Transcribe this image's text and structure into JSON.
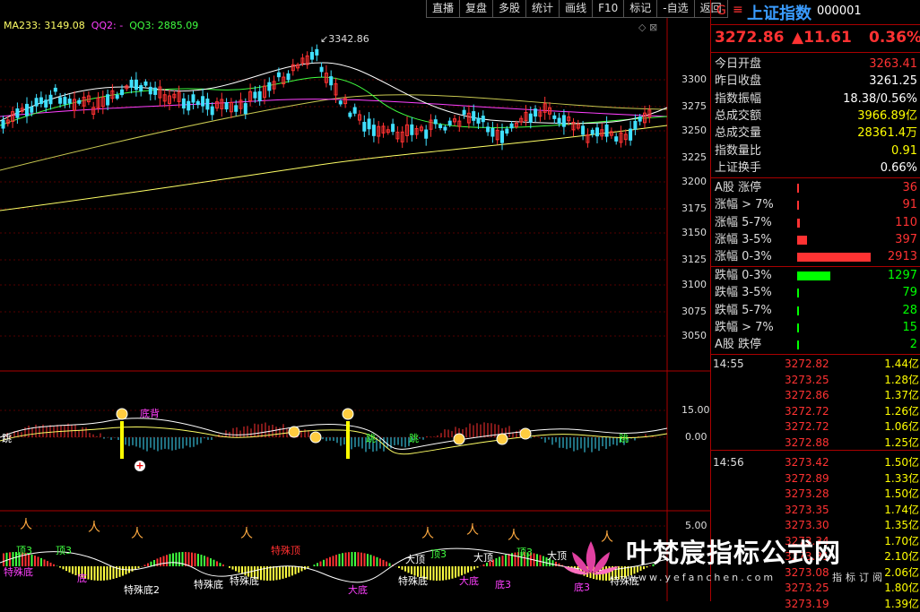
{
  "toolbar": [
    "直播",
    "复盘",
    "多股",
    "统计",
    "画线",
    "F10",
    "标记",
    "-自选",
    "返回"
  ],
  "ma_legend": {
    "ma": "MA233: 3149.08",
    "qq2": "QQ2: -",
    "qq3": "QQ3: 2885.09"
  },
  "price_axis": [
    "3300",
    "3275",
    "3250",
    "3225",
    "3200",
    "3175",
    "3150",
    "3125",
    "3100",
    "3075",
    "3050"
  ],
  "high_label": "3342.86",
  "ind1_axis": [
    "15.00",
    "0.00"
  ],
  "ind2_axis": [
    "5.00"
  ],
  "signals_mid": {
    "dibei": "底背",
    "jump": "跳"
  },
  "signals_low": {
    "ding3": "顶3",
    "dading": "大顶",
    "tesuding": "特殊顶",
    "di": "底",
    "tesudi": "特殊底",
    "tesudi2": "特殊底2",
    "dadi": "大底",
    "di3": "底3"
  },
  "header": {
    "g": "G",
    "menu": "≡",
    "title": "上证指数",
    "code": "000001"
  },
  "quote": {
    "price": "3272.86",
    "change": "▲11.61",
    "pct": "0.36%"
  },
  "stats": [
    {
      "label": "今日开盘",
      "value": "3263.41",
      "color": "#ff3232"
    },
    {
      "label": "昨日收盘",
      "value": "3261.25",
      "color": "#ffffff"
    },
    {
      "label": "指数振幅",
      "value": "18.38/0.56%",
      "color": "#ffffff"
    },
    {
      "label": "总成交额",
      "value": "3966.89亿",
      "color": "#ffff00"
    },
    {
      "label": "总成交量",
      "value": "28361.4万",
      "color": "#ffff00"
    },
    {
      "label": "指数量比",
      "value": "0.91",
      "color": "#ffff00"
    },
    {
      "label": "上证换手",
      "value": "0.66%",
      "color": "#ffffff"
    }
  ],
  "breadth": [
    {
      "label": "A股 涨停",
      "value": "36",
      "color": "#ff3232",
      "bar": 0.0
    },
    {
      "label": "涨幅 > 7%",
      "value": "91",
      "color": "#ff3232",
      "bar": 0.03
    },
    {
      "label": "涨幅 5-7%",
      "value": "110",
      "color": "#ff3232",
      "bar": 0.04
    },
    {
      "label": "涨幅 3-5%",
      "value": "397",
      "color": "#ff3232",
      "bar": 0.14
    },
    {
      "label": "涨幅 0-3%",
      "value": "2913",
      "color": "#ff3232",
      "bar": 1.0
    },
    {
      "label": "跌幅 0-3%",
      "value": "1297",
      "color": "#00ff00",
      "bar": 0.45
    },
    {
      "label": "跌幅 3-5%",
      "value": "79",
      "color": "#00ff00",
      "bar": 0.03
    },
    {
      "label": "跌幅 5-7%",
      "value": "28",
      "color": "#00ff00",
      "bar": 0.01
    },
    {
      "label": "跌幅 > 7%",
      "value": "15",
      "color": "#00ff00",
      "bar": 0.01
    },
    {
      "label": "A股 跌停",
      "value": "2",
      "color": "#00ff00",
      "bar": 0.0
    }
  ],
  "ticks": [
    {
      "time": "14:55",
      "price": "3272.82",
      "vol": "1.44亿"
    },
    {
      "time": "",
      "price": "3273.25",
      "vol": "1.28亿"
    },
    {
      "time": "",
      "price": "3272.86",
      "vol": "1.37亿"
    },
    {
      "time": "",
      "price": "3272.72",
      "vol": "1.26亿"
    },
    {
      "time": "",
      "price": "3272.72",
      "vol": "1.06亿"
    },
    {
      "time": "",
      "price": "3272.88",
      "vol": "1.25亿"
    },
    {
      "time": "14:56",
      "price": "3273.42",
      "vol": "1.50亿"
    },
    {
      "time": "",
      "price": "3272.89",
      "vol": "1.33亿"
    },
    {
      "time": "",
      "price": "3273.28",
      "vol": "1.50亿"
    },
    {
      "time": "",
      "price": "3273.35",
      "vol": "1.74亿"
    },
    {
      "time": "",
      "price": "3273.30",
      "vol": "1.35亿"
    },
    {
      "time": "",
      "price": "3273.34",
      "vol": "1.70亿"
    },
    {
      "time": "",
      "price": "3273.31",
      "vol": "2.10亿"
    },
    {
      "time": "",
      "price": "3273.08",
      "vol": "2.06亿"
    },
    {
      "time": "",
      "price": "3273.25",
      "vol": "1.80亿"
    },
    {
      "time": "",
      "price": "3273.19",
      "vol": "1.39亿"
    }
  ],
  "watermark": {
    "title": "叶梵宸指标公式网",
    "url": "www.yefanchen.com",
    "sub": "指标订阅"
  }
}
